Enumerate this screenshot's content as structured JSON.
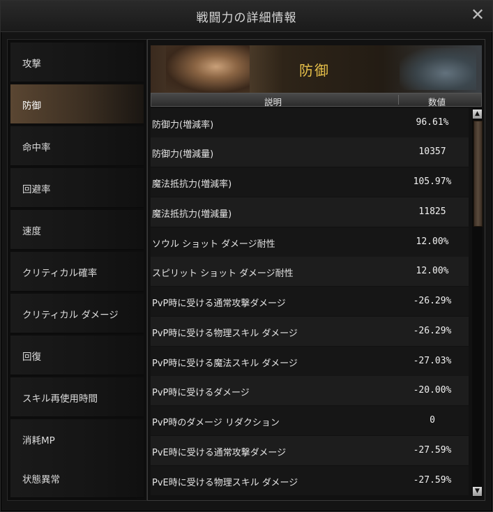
{
  "window": {
    "title": "戦闘力の詳細情報",
    "close_glyph": "✕"
  },
  "sidebar": {
    "items": [
      {
        "label": "攻撃"
      },
      {
        "label": "防御"
      },
      {
        "label": "命中率"
      },
      {
        "label": "回避率"
      },
      {
        "label": "速度"
      },
      {
        "label": "クリティカル確率"
      },
      {
        "label": "クリティカル ダメージ"
      },
      {
        "label": "回復"
      },
      {
        "label": "スキル再使用時間"
      },
      {
        "label": "消耗MP"
      },
      {
        "label": "状態異常"
      }
    ],
    "selected_index": 1
  },
  "banner": {
    "title": "防御"
  },
  "table": {
    "headers": {
      "description": "説明",
      "value": "数値"
    },
    "rows": [
      {
        "desc": "防御力(増減率)",
        "value": "96.61%"
      },
      {
        "desc": "防御力(増減量)",
        "value": "10357"
      },
      {
        "desc": "魔法抵抗力(増減率)",
        "value": "105.97%"
      },
      {
        "desc": "魔法抵抗力(増減量)",
        "value": "11825"
      },
      {
        "desc": "ソウル ショット ダメージ耐性",
        "value": "12.00%"
      },
      {
        "desc": "スピリット ショット ダメージ耐性",
        "value": "12.00%"
      },
      {
        "desc": "PvP時に受ける通常攻撃ダメージ",
        "value": "-26.29%"
      },
      {
        "desc": "PvP時に受ける物理スキル ダメージ",
        "value": "-26.29%"
      },
      {
        "desc": "PvP時に受ける魔法スキル ダメージ",
        "value": "-27.03%"
      },
      {
        "desc": "PvP時に受けるダメージ",
        "value": "-20.00%"
      },
      {
        "desc": "PvP時のダメージ リダクション",
        "value": "0"
      },
      {
        "desc": "PvE時に受ける通常攻撃ダメージ",
        "value": "-27.59%"
      },
      {
        "desc": "PvE時に受ける物理スキル ダメージ",
        "value": "-27.59%"
      }
    ]
  },
  "scrollbar": {
    "up_glyph": "▲",
    "down_glyph": "▼"
  },
  "colors": {
    "accent": "#e8c14a",
    "selected": "#5a4632"
  }
}
